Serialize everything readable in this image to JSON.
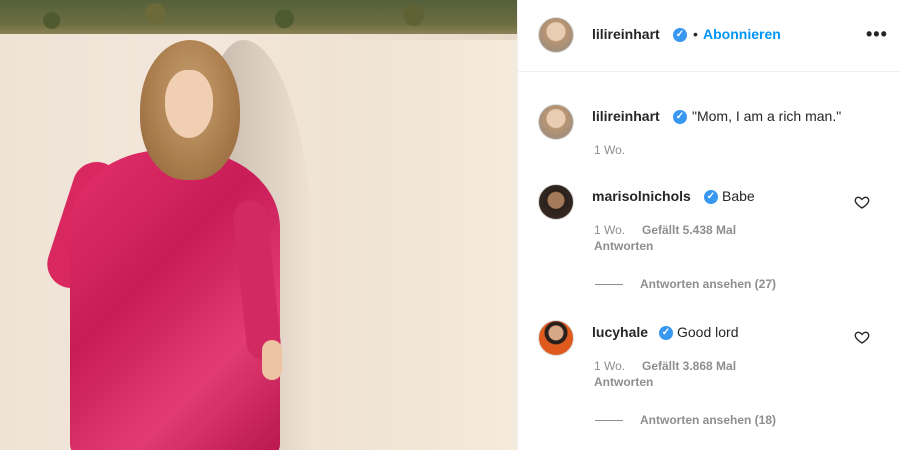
{
  "post": {
    "author": "lilireinhart",
    "follow_label": "Abonnieren",
    "separator": "•",
    "more_label": "•••",
    "verified_glyph": "✓"
  },
  "caption": {
    "author": "lilireinhart",
    "text": "\"Mom, I am a rich man.\"",
    "time": "1 Wo."
  },
  "comments": [
    {
      "author": "marisolnichols",
      "text": "Babe",
      "time": "1 Wo.",
      "likes": "Gefällt 5.438 Mal",
      "reply_label": "Antworten",
      "view_replies": "Antworten ansehen (27)"
    },
    {
      "author": "lucyhale",
      "text": "Good lord",
      "time": "1 Wo.",
      "likes": "Gefällt 3.868 Mal",
      "reply_label": "Antworten",
      "view_replies": "Antworten ansehen (18)"
    }
  ],
  "icons": {
    "verified": "verified-badge-icon",
    "heart": "heart-outline-icon",
    "more": "more-options-icon"
  },
  "colors": {
    "link_blue": "#0095f6",
    "verified_blue": "#3897f0",
    "muted_text": "#8e8e8e",
    "dress_pink": "#d8285f"
  }
}
